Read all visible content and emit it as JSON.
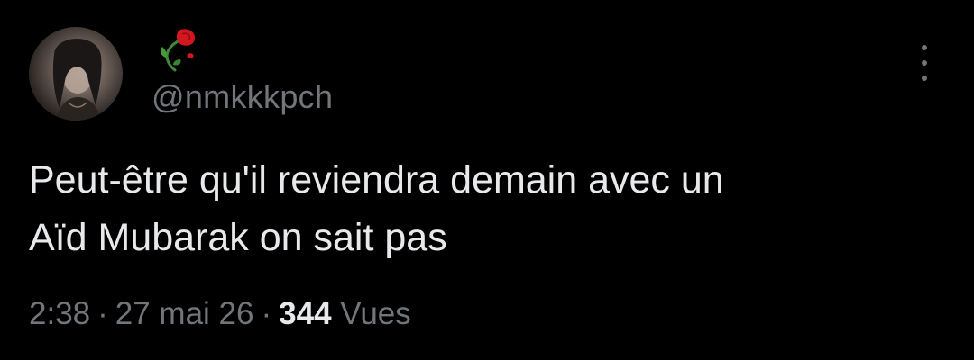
{
  "tweet": {
    "display_name_emoji": "wilted-rose-emoji",
    "handle": "@nmkkkpch",
    "text": "Peut-être qu'il reviendra demain avec un\nAïd Mubarak on sait pas",
    "time": "2:38",
    "separator": "·",
    "date": "27 mai 26",
    "views_count": "344",
    "views_label": "Vues"
  },
  "icons": {
    "more": "more-vertical-icon",
    "avatar": "profile-photo"
  },
  "colors": {
    "background": "#000000",
    "primary_text": "#e7e9ea",
    "secondary_text": "#71767b",
    "rose_red": "#d4161e",
    "stem_green": "#3f8a34"
  }
}
